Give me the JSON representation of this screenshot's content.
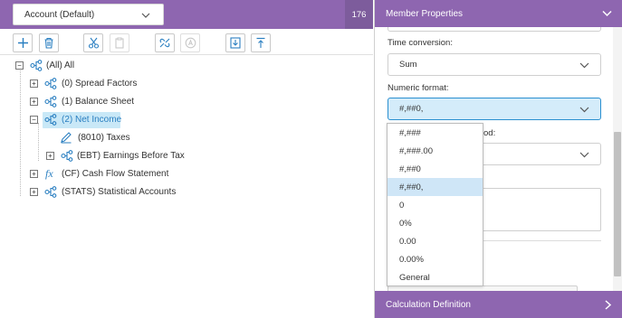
{
  "left_panel": {
    "account_select": {
      "value": "Account (Default)"
    },
    "count_badge": "176",
    "toolbar": {
      "buttons": [
        {
          "name": "add-button",
          "icon": "plus-icon"
        },
        {
          "name": "delete-button",
          "icon": "trash-icon"
        },
        {
          "name": "cut-button",
          "icon": "scissors-icon"
        },
        {
          "name": "paste-button",
          "icon": "clipboard-icon"
        },
        {
          "name": "relationship-button",
          "icon": "link-icon"
        },
        {
          "name": "alias-button",
          "icon": "alias-icon"
        },
        {
          "name": "import-button",
          "icon": "import-icon"
        },
        {
          "name": "export-button",
          "icon": "export-icon"
        }
      ]
    },
    "tree": {
      "items": [
        {
          "label": "(All) All",
          "icon": "hierarchy-icon",
          "expander": "minus"
        },
        {
          "label": "(0) Spread Factors",
          "icon": "hierarchy-icon",
          "expander": "plus"
        },
        {
          "label": "(1) Balance Sheet",
          "icon": "hierarchy-icon",
          "expander": "plus"
        },
        {
          "label": "(2) Net Income",
          "icon": "hierarchy-icon",
          "expander": "minus",
          "selected": true
        },
        {
          "label": "(8010) Taxes",
          "icon": "pencil-icon"
        },
        {
          "label": "(EBT) Earnings Before Tax",
          "icon": "hierarchy-icon",
          "expander": "plus"
        },
        {
          "label": "(CF) Cash Flow Statement",
          "icon": "formula-icon",
          "expander": "plus"
        },
        {
          "label": "(STATS) Statistical Accounts",
          "icon": "hierarchy-icon",
          "expander": "plus"
        }
      ]
    }
  },
  "right_panel": {
    "header": "Member Properties",
    "fields": {
      "time_conversion": {
        "label": "Time conversion:",
        "value": "Sum"
      },
      "numeric_format": {
        "label": "Numeric format:",
        "value": "#,##0,"
      },
      "partial_label": "od:"
    },
    "footer": "Calculation Definition"
  },
  "dropdown": {
    "options": [
      "#,###",
      "#,###.00",
      "#,##0",
      "#,##0,",
      "0",
      "0%",
      "0.00",
      "0.00%",
      "General"
    ],
    "selected_index": 3
  },
  "colors": {
    "header_purple": "#8e66b0",
    "badge_purple": "#7d5c9c",
    "selection_blue": "#c9e8f7",
    "active_field_blue": "#d4ecfa",
    "icon_blue": "#2a7fc1"
  }
}
